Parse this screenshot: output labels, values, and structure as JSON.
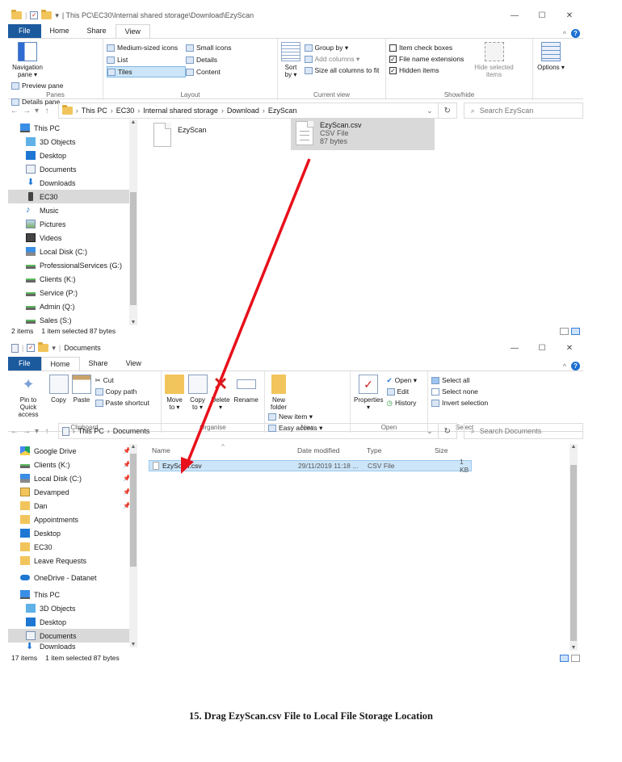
{
  "top": {
    "title": "| This PC\\EC30\\Internal shared storage\\Download\\EzyScan",
    "tabs": [
      "File",
      "Home",
      "Share",
      "View"
    ],
    "ribbon": {
      "navigation_pane": "Navigation pane ▾",
      "preview_pane": "Preview pane",
      "details_pane": "Details pane",
      "panes_label": "Panes",
      "layout_items": [
        "Medium-sized icons",
        "Small icons",
        "List",
        "Details",
        "Tiles",
        "Content"
      ],
      "layout_label": "Layout",
      "sort_by": "Sort by ▾",
      "group_by": "Group by ▾",
      "add_columns": "Add columns ▾",
      "size_all_columns": "Size all columns to fit",
      "current_view_label": "Current view",
      "item_check_boxes": "Item check boxes",
      "file_name_extensions": "File name extensions",
      "hidden_items": "Hidden items",
      "hide_selected": "Hide selected items",
      "options": "Options ▾",
      "show_hide_label": "Show/hide"
    },
    "breadcrumb": [
      "This PC",
      "EC30",
      "Internal shared storage",
      "Download",
      "EzyScan"
    ],
    "search_placeholder": "Search EzyScan",
    "nav_items": [
      "This PC",
      "3D Objects",
      "Desktop",
      "Documents",
      "Downloads",
      "EC30",
      "Music",
      "Pictures",
      "Videos",
      "Local Disk (C:)",
      "ProfessionalServices (G:)",
      "Clients (K:)",
      "Service (P:)",
      "Admin (Q:)",
      "Sales (S:)"
    ],
    "files": [
      {
        "name": "EzyScan"
      },
      {
        "name": "EzyScan.csv",
        "type": "CSV File",
        "size": "87 bytes"
      }
    ],
    "status_items": "2 items",
    "status_selected": "1 item selected  87 bytes"
  },
  "bottom": {
    "title": "Documents",
    "tabs": [
      "File",
      "Home",
      "Share",
      "View"
    ],
    "ribbon": {
      "pin_to_quick": "Pin to Quick access",
      "copy": "Copy",
      "paste": "Paste",
      "cut": "Cut",
      "copy_path": "Copy path",
      "paste_shortcut": "Paste shortcut",
      "clipboard_label": "Clipboard",
      "move_to": "Move to ▾",
      "copy_to": "Copy to ▾",
      "delete": "Delete ▾",
      "rename": "Rename",
      "organise_label": "Organise",
      "new_folder": "New folder",
      "new_item": "New item ▾",
      "easy_access": "Easy access ▾",
      "new_label": "New",
      "properties": "Properties ▾",
      "open": "Open ▾",
      "edit": "Edit",
      "history": "History",
      "open_label": "Open",
      "select_all": "Select all",
      "select_none": "Select none",
      "invert_selection": "Invert selection",
      "select_label": "Select"
    },
    "breadcrumb": [
      "This PC",
      "Documents"
    ],
    "search_placeholder": "Search Documents",
    "nav_items": [
      "Google Drive",
      "Clients (K:)",
      "Local Disk (C:)",
      "Devamped",
      "Dan",
      "Appointments",
      "Desktop",
      "EC30",
      "Leave Requests",
      "OneDrive - Datanet",
      "This PC",
      "3D Objects",
      "Desktop",
      "Documents",
      "Downloads"
    ],
    "columns": [
      "Name",
      "Date modified",
      "Type",
      "Size"
    ],
    "rows": [
      {
        "name": "EzyScan.csv",
        "date": "29/11/2019 11:18 ...",
        "type": "CSV File",
        "size": "1 KB"
      }
    ],
    "status_items": "17 items",
    "status_selected": "1 item selected  87 bytes"
  },
  "caption": "15. Drag EzyScan.csv File to Local File Storage Location",
  "colors": {
    "arrow": "#e8101a",
    "selection": "#cce5f8",
    "file_tab": "#1c5a9e"
  }
}
